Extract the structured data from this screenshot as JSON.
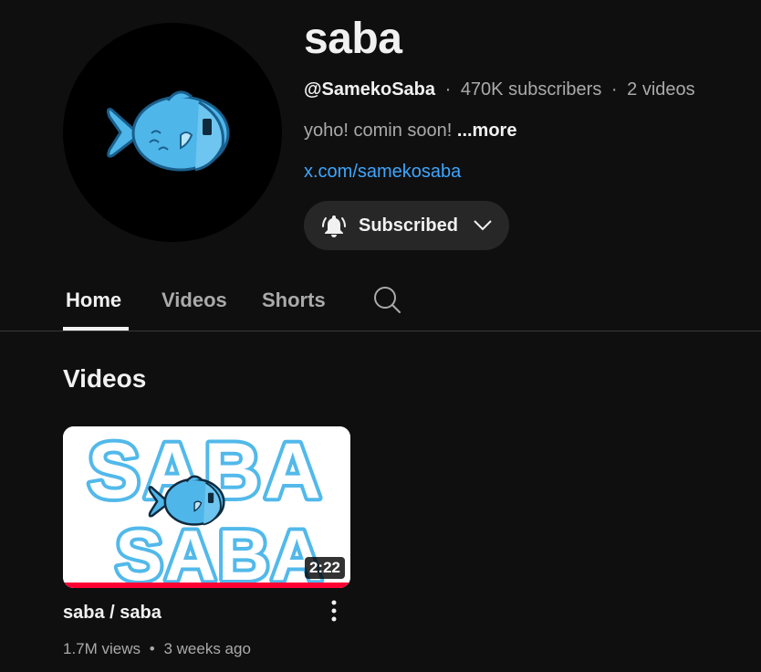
{
  "channel": {
    "title": "saba",
    "handle": "@SamekoSaba",
    "subscribers": "470K subscribers",
    "video_count": "2 videos",
    "separator": "·",
    "description": "yoho! comin soon!",
    "more_label": "...more",
    "link": "x.com/samekosaba",
    "subscribe_label": "Subscribed",
    "avatar_icon": "fish-icon"
  },
  "tabs": [
    {
      "label": "Home",
      "active": true
    },
    {
      "label": "Videos",
      "active": false
    },
    {
      "label": "Shorts",
      "active": false
    }
  ],
  "section": {
    "title": "Videos"
  },
  "videos": [
    {
      "thumbnail_text_top": "SABA",
      "thumbnail_text_bottom": "SABA",
      "duration": "2:22",
      "title": "saba / saba",
      "views": "1.7M views",
      "separator": "•",
      "age": "3 weeks ago",
      "watched": 1
    }
  ],
  "colors": {
    "background": "#0f0f0f",
    "link": "#3ea6ff",
    "fish": "#4fb6ea",
    "progress": "#ff0033"
  }
}
